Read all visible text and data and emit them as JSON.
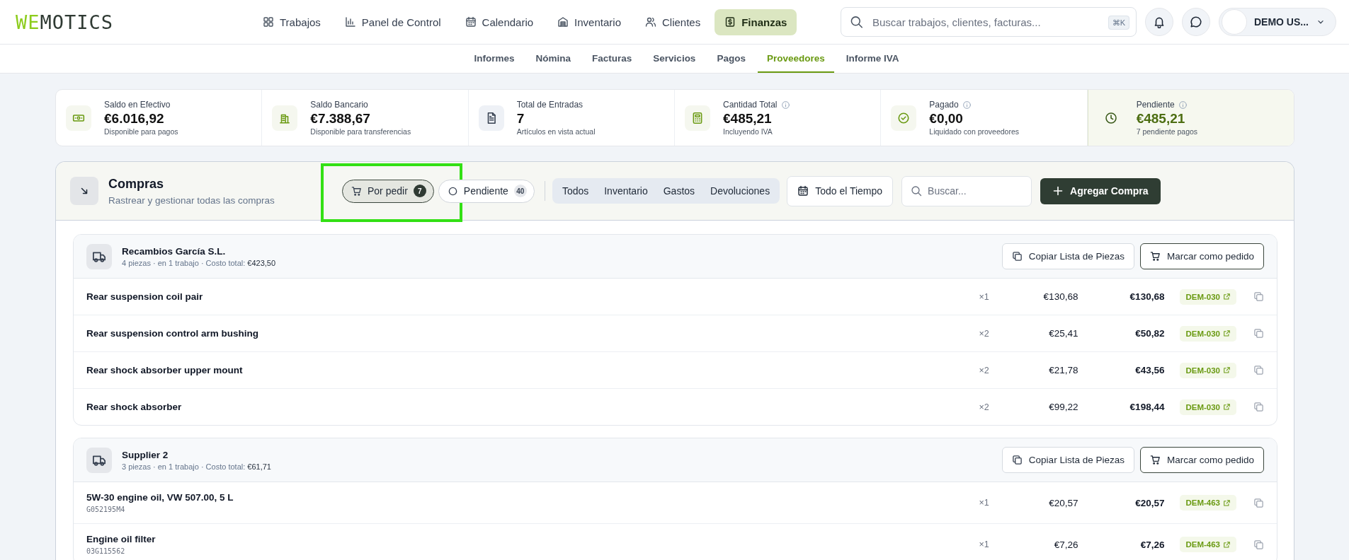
{
  "header": {
    "logo": {
      "accent": "WE",
      "rest": "MOTICS"
    },
    "nav": [
      {
        "label": "Trabajos",
        "selected": false
      },
      {
        "label": "Panel de Control",
        "selected": false
      },
      {
        "label": "Calendario",
        "selected": false
      },
      {
        "label": "Inventario",
        "selected": false
      },
      {
        "label": "Clientes",
        "selected": false
      },
      {
        "label": "Finanzas",
        "selected": true
      }
    ],
    "search": {
      "placeholder": "Buscar trabajos, clientes, facturas...",
      "shortcut": "⌘K"
    },
    "user": {
      "name": "DEMO US..."
    }
  },
  "subnav": [
    {
      "label": "Informes",
      "selected": false
    },
    {
      "label": "Nómina",
      "selected": false
    },
    {
      "label": "Facturas",
      "selected": false
    },
    {
      "label": "Servicios",
      "selected": false
    },
    {
      "label": "Pagos",
      "selected": false
    },
    {
      "label": "Proveedores",
      "selected": true
    },
    {
      "label": "Informe IVA",
      "selected": false
    }
  ],
  "stats": [
    {
      "title": "Saldo en Efectivo",
      "value": "€6.016,92",
      "note": "Disponible para pagos",
      "info": false,
      "highlighted": false
    },
    {
      "title": "Saldo Bancario",
      "value": "€7.388,67",
      "note": "Disponible para transferencias",
      "info": false,
      "highlighted": false
    },
    {
      "title": "Total de Entradas",
      "value": "7",
      "note": "Artículos en vista actual",
      "info": false,
      "highlighted": false
    },
    {
      "title": "Cantidad Total",
      "value": "€485,21",
      "note": "Incluyendo IVA",
      "info": true,
      "highlighted": false
    },
    {
      "title": "Pagado",
      "value": "€0,00",
      "note": "Liquidado con proveedores",
      "info": true,
      "highlighted": false
    },
    {
      "title": "Pendiente",
      "value": "€485,21",
      "note": "7 pendiente pagos",
      "info": true,
      "highlighted": true
    }
  ],
  "purchases": {
    "title": "Compras",
    "subtitle": "Rastrear y gestionar todas las compras",
    "status_filters": [
      {
        "label": "Por pedir",
        "count": "7",
        "selected": true,
        "highlighted": true
      },
      {
        "label": "Pendiente",
        "count": "40",
        "selected": false,
        "highlighted": false
      }
    ],
    "categories": [
      {
        "label": "Todos",
        "selected": false
      },
      {
        "label": "Inventario",
        "selected": false
      },
      {
        "label": "Gastos",
        "selected": false
      },
      {
        "label": "Devoluciones",
        "selected": false
      }
    ],
    "date_filter": "Todo el Tiempo",
    "search": {
      "placeholder": "Buscar..."
    },
    "add_button": "Agregar Compra",
    "groups": [
      {
        "supplier": "Recambios García S.L.",
        "meta": "4 piezas · en 1 trabajo · Costo total: **€423,50**",
        "copy_button": "Copiar Lista de Piezas",
        "order_button": "Marcar como pedido",
        "items": [
          {
            "name": "Rear suspension coil pair",
            "qty": "×1",
            "unit": "€130,68",
            "total": "€130,68",
            "job": "DEM-030"
          },
          {
            "name": "Rear suspension control arm bushing",
            "qty": "×2",
            "unit": "€25,41",
            "total": "€50,82",
            "job": "DEM-030"
          },
          {
            "name": "Rear shock absorber upper mount",
            "qty": "×2",
            "unit": "€21,78",
            "total": "€43,56",
            "job": "DEM-030"
          },
          {
            "name": "Rear shock absorber",
            "qty": "×2",
            "unit": "€99,22",
            "total": "€198,44",
            "job": "DEM-030"
          }
        ]
      },
      {
        "supplier": "Supplier 2",
        "meta": "3 piezas · en 1 trabajo · Costo total: **€61,71**",
        "copy_button": "Copiar Lista de Piezas",
        "order_button": "Marcar como pedido",
        "items": [
          {
            "name": "5W-30 engine oil, VW 507.00, 5 L",
            "part_number": "G052195M4",
            "qty": "×1",
            "unit": "€20,57",
            "total": "€20,57",
            "job": "DEM-463"
          },
          {
            "name": "Engine oil filter",
            "part_number": "03G115562",
            "qty": "×1",
            "unit": "€7,26",
            "total": "€7,26",
            "job": "DEM-463"
          }
        ]
      }
    ]
  }
}
